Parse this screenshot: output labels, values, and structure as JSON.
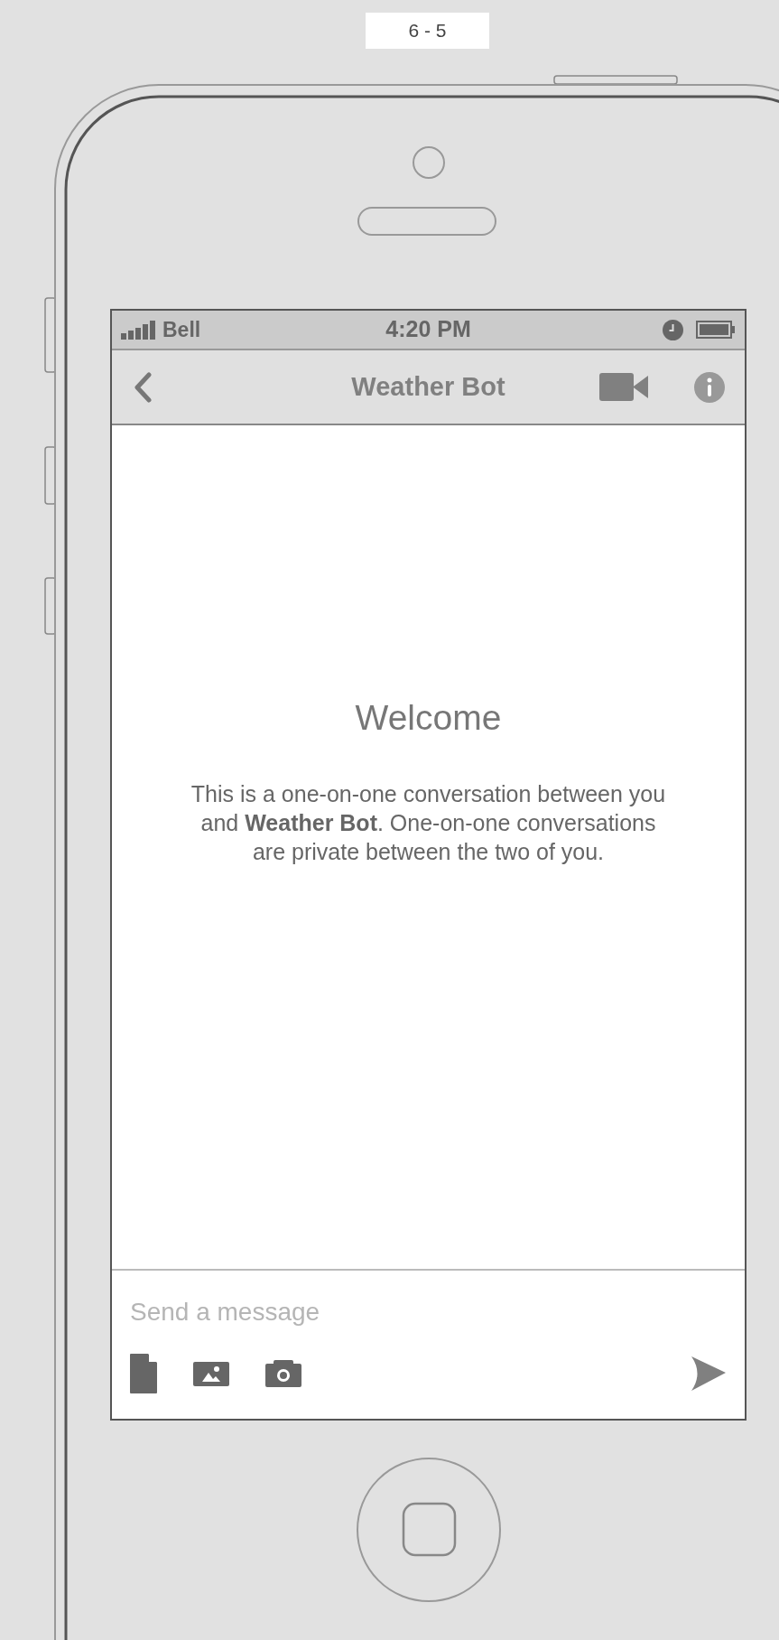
{
  "label": "6 - 5",
  "status_bar": {
    "carrier": "Bell",
    "time": "4:20 PM"
  },
  "nav_bar": {
    "title": "Weather Bot"
  },
  "welcome": {
    "title": "Welcome",
    "text": "This is a one-on-one conversation between you and **Weather Bot**. One-on-one conversations are private between the two of you."
  },
  "composer": {
    "placeholder": "Send a message"
  }
}
